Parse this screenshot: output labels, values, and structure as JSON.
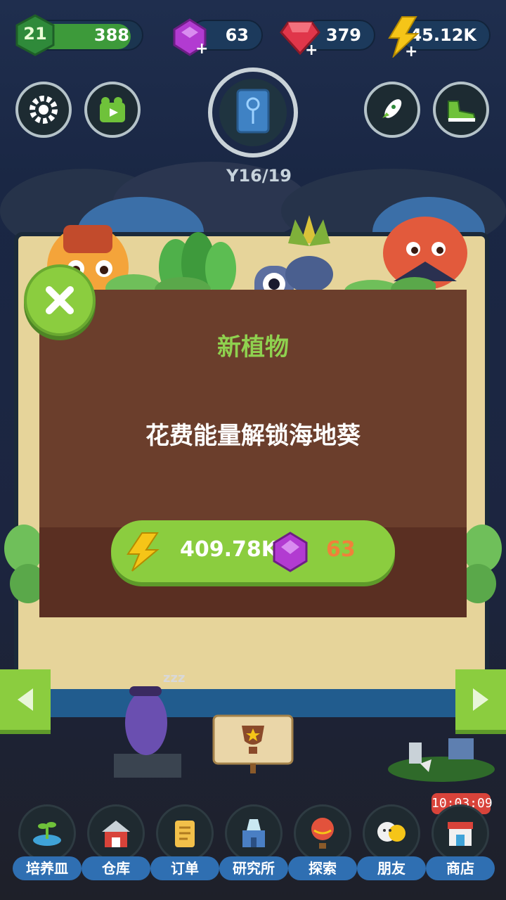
{
  "header": {
    "level": "21",
    "level_progress_value": "388",
    "gems": "63",
    "rubies": "379",
    "energy": "545.12K",
    "plant_count": "16/19"
  },
  "dialog": {
    "title": "新植物",
    "message": "花费能量解锁海地葵",
    "cost_energy": "409.78K",
    "cost_gems": "63"
  },
  "timer": "10:03:09",
  "nav": [
    {
      "label": "培养皿",
      "icon": "seedling-dish-icon"
    },
    {
      "label": "仓库",
      "icon": "barn-icon"
    },
    {
      "label": "订单",
      "icon": "scroll-icon"
    },
    {
      "label": "研究所",
      "icon": "lab-icon"
    },
    {
      "label": "探索",
      "icon": "hot-air-balloon-icon"
    },
    {
      "label": "朋友",
      "icon": "friends-icon"
    },
    {
      "label": "商店",
      "icon": "shop-icon"
    }
  ],
  "colors": {
    "accent_green": "#8bcd3f",
    "dialog_brown": "#6b3e2c",
    "title_green": "#8fd14f",
    "gem_count_orange": "#f0813a",
    "nav_blue": "#2f6fb2"
  }
}
